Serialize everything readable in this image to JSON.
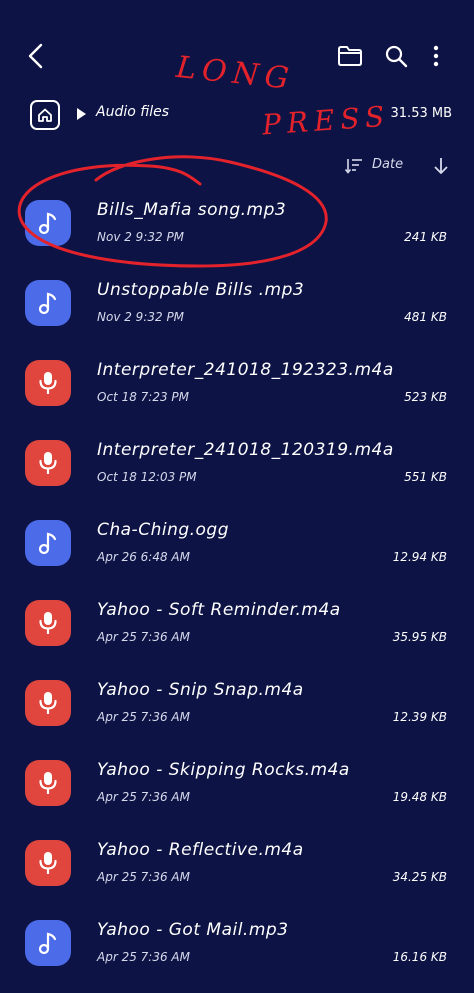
{
  "path": {
    "folder": "Audio files",
    "total_size": "31.53 MB"
  },
  "sort": {
    "label": "Date"
  },
  "files": [
    {
      "name": "Bills_Mafia song.mp3",
      "date": "Nov 2 9:32 PM",
      "size": "241 KB",
      "type": "audio"
    },
    {
      "name": "Unstoppable Bills .mp3",
      "date": "Nov 2 9:32 PM",
      "size": "481 KB",
      "type": "audio"
    },
    {
      "name": "Interpreter_241018_192323.m4a",
      "date": "Oct 18 7:23 PM",
      "size": "523 KB",
      "type": "voice"
    },
    {
      "name": "Interpreter_241018_120319.m4a",
      "date": "Oct 18 12:03 PM",
      "size": "551 KB",
      "type": "voice"
    },
    {
      "name": "Cha-Ching.ogg",
      "date": "Apr 26 6:48 AM",
      "size": "12.94 KB",
      "type": "audio"
    },
    {
      "name": "Yahoo - Soft Reminder.m4a",
      "date": "Apr 25 7:36 AM",
      "size": "35.95 KB",
      "type": "voice"
    },
    {
      "name": "Yahoo - Snip Snap.m4a",
      "date": "Apr 25 7:36 AM",
      "size": "12.39 KB",
      "type": "voice"
    },
    {
      "name": "Yahoo - Skipping Rocks.m4a",
      "date": "Apr 25 7:36 AM",
      "size": "19.48 KB",
      "type": "voice"
    },
    {
      "name": "Yahoo - Reflective.m4a",
      "date": "Apr 25 7:36 AM",
      "size": "34.25 KB",
      "type": "voice"
    },
    {
      "name": "Yahoo - Got Mail.mp3",
      "date": "Apr 25 7:36 AM",
      "size": "16.16 KB",
      "type": "audio"
    }
  ],
  "annotation": {
    "line1": "LONG",
    "line2": "PRESS",
    "color": "#e3222b"
  },
  "colors": {
    "background": "#0d1445",
    "audio_icon": "#4b6be8",
    "voice_icon": "#e0453e"
  },
  "icons": {
    "back": "back-arrow-icon",
    "folder": "folder-icon",
    "search": "search-icon",
    "more": "more-vertical-icon",
    "home": "home-icon",
    "sort": "sort-icon",
    "sort_direction": "arrow-down-icon",
    "audio": "music-note-icon",
    "voice": "microphone-icon"
  }
}
